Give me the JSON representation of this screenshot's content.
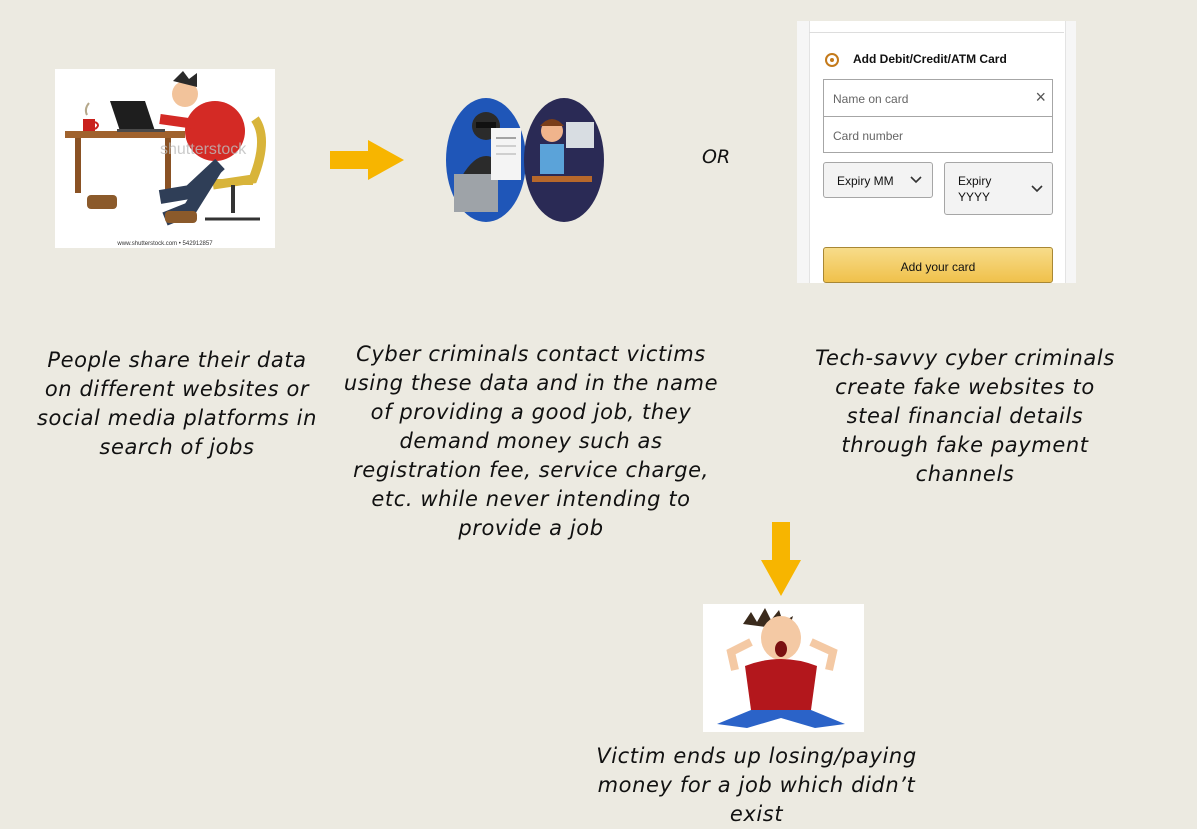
{
  "diagram": {
    "separator": "OR",
    "steps": [
      {
        "caption": "People share their data on different websites or social media platforms in search of jobs",
        "image_watermark": "shutterstock",
        "image_footer": "www.shutterstock.com • 542912857"
      },
      {
        "caption": "Cyber criminals contact victims using these data and in the name of providing a good job, they demand money such as registration fee, service charge, etc. while never intending to provide a job"
      },
      {
        "caption": "Tech-savvy cyber criminals create fake websites to steal financial details through fake payment channels"
      },
      {
        "caption": "Victim ends up losing/paying money for a job which didn’t exist"
      }
    ]
  },
  "card_form": {
    "title": "Add Debit/Credit/ATM Card",
    "name_placeholder": "Name on card",
    "number_placeholder": "Card number",
    "expiry_month": "Expiry MM",
    "expiry_year_line1": "Expiry",
    "expiry_year_line2": "YYYY",
    "submit_label": "Add your card",
    "clear_icon": "×"
  },
  "colors": {
    "arrow": "#f7b500",
    "background": "#eceae1"
  }
}
